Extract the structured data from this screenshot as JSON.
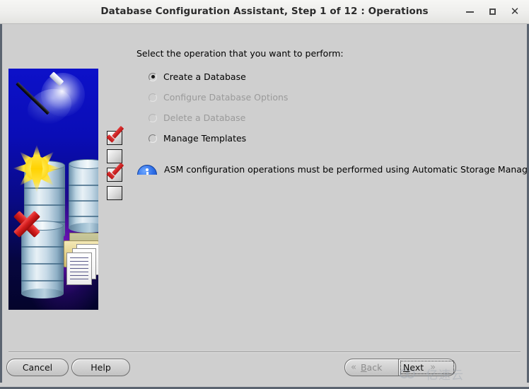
{
  "window": {
    "title": "Database Configuration Assistant, Step 1 of 12 : Operations",
    "minimize_label": "–",
    "maximize_label": "",
    "close_label": "✕"
  },
  "content": {
    "prompt": "Select the operation that you want to perform:",
    "options": [
      {
        "label": "Create a Database",
        "selected": true,
        "disabled": false
      },
      {
        "label": "Configure Database Options",
        "selected": false,
        "disabled": true
      },
      {
        "label": "Delete a Database",
        "selected": false,
        "disabled": true
      },
      {
        "label": "Manage Templates",
        "selected": false,
        "disabled": false
      }
    ],
    "note": {
      "icon": "info-icon",
      "text": "ASM configuration operations must be performed using Automatic Storage Managemer"
    }
  },
  "buttons": {
    "cancel": "Cancel",
    "help": "Help",
    "back": "Back",
    "back_mnemonic": "B",
    "back_chevron": "«",
    "next": "Next",
    "next_mnemonic": "N",
    "next_chevron": "»"
  },
  "watermark": {
    "text": "亿速云"
  },
  "colors": {
    "window_bg": "#cfcfcf",
    "titlebar_bg": "#eeeeec",
    "banner_blue": "#0d11c9",
    "banner_purple": "#7a14c8",
    "accent_red": "#d61d1d",
    "accent_yellow": "#ffd200",
    "info_blue": "#2f6fe8",
    "disabled_text": "#9a9a9a"
  }
}
